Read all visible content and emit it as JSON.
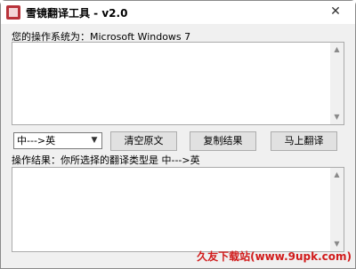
{
  "window": {
    "title": "雪镜翻译工具 - v2.0",
    "close_glyph": "✕"
  },
  "os_label": "您的操作系统为：Microsoft Windows 7",
  "input_area": {
    "value": ""
  },
  "direction_select": {
    "value": "中--->英"
  },
  "buttons": {
    "clear": "清空原文",
    "copy": "复制结果",
    "translate": "马上翻译"
  },
  "result_label": "操作结果：你所选择的翻译类型是  中--->英",
  "output_area": {
    "value": ""
  },
  "watermark": "久友下载站(www.9upk.com)"
}
